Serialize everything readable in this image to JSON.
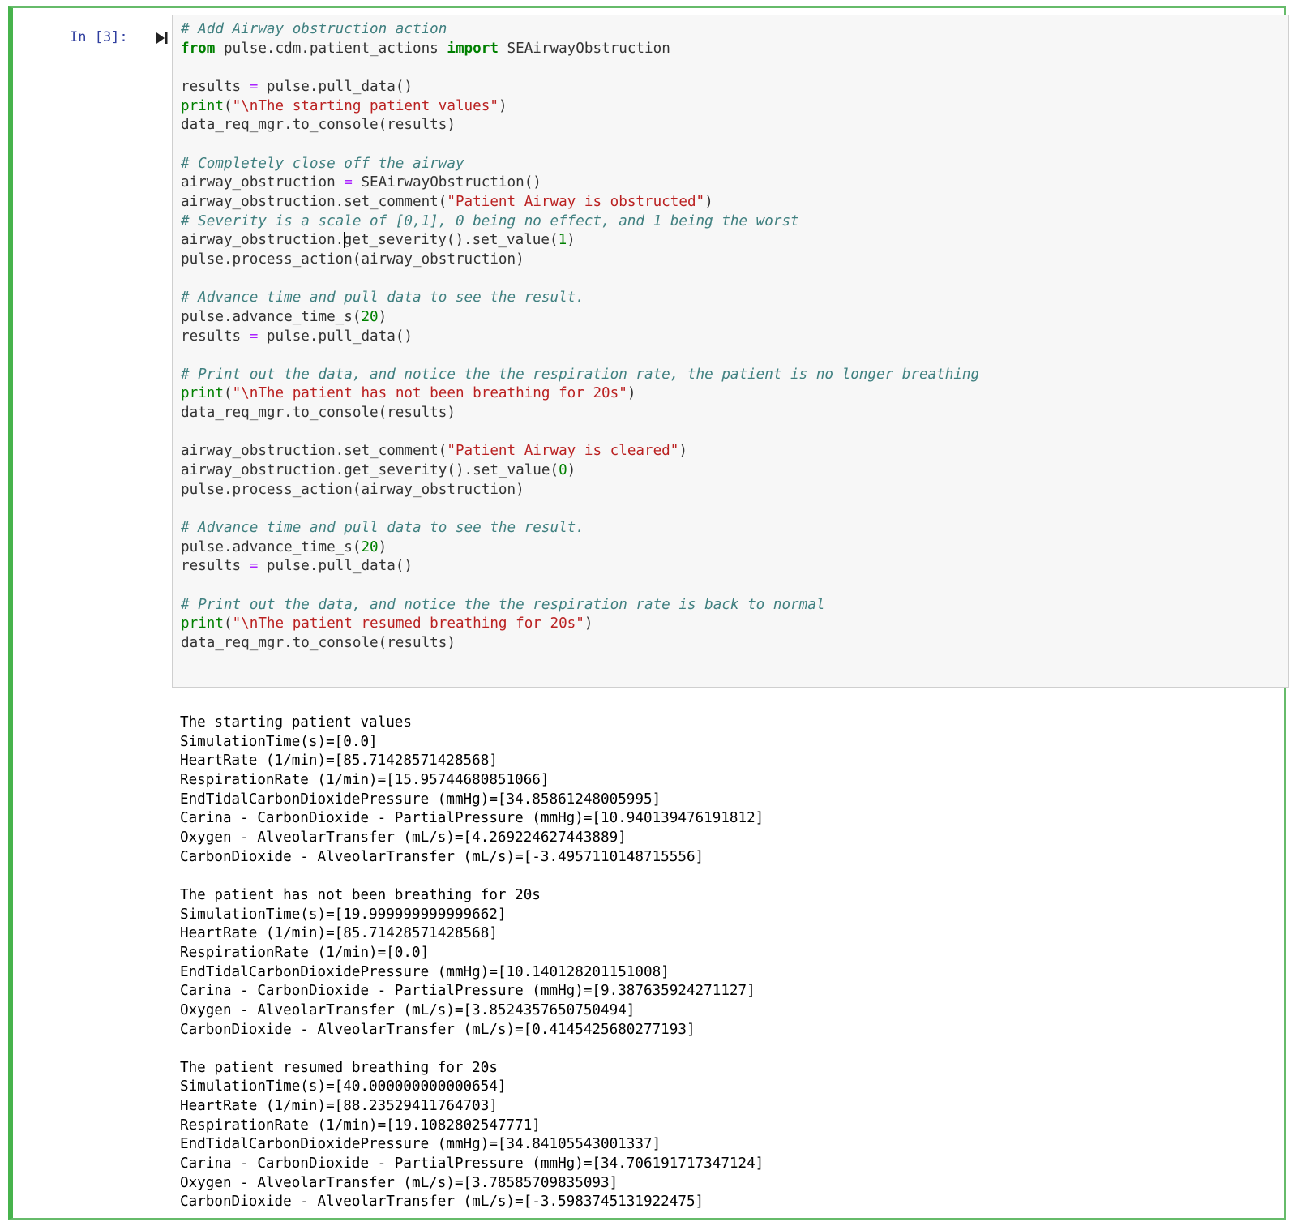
{
  "cell": {
    "prompt": "In [3]:",
    "run_icon": "run-cell-icon",
    "accent_color": "#47b34c"
  },
  "code_lines": [
    {
      "id": "l1",
      "tokens": [
        {
          "t": "cm",
          "v": "# Add Airway obstruction action"
        }
      ]
    },
    {
      "id": "l2",
      "tokens": [
        {
          "t": "kw",
          "v": "from"
        },
        {
          "t": "",
          "v": " pulse.cdm.patient_actions "
        },
        {
          "t": "kw",
          "v": "import"
        },
        {
          "t": "",
          "v": " SEAirwayObstruction"
        }
      ]
    },
    {
      "id": "l3",
      "tokens": []
    },
    {
      "id": "l4",
      "tokens": [
        {
          "t": "",
          "v": "results "
        },
        {
          "t": "op",
          "v": "="
        },
        {
          "t": "",
          "v": " pulse.pull_data()"
        }
      ]
    },
    {
      "id": "l5",
      "tokens": [
        {
          "t": "bi",
          "v": "print"
        },
        {
          "t": "",
          "v": "("
        },
        {
          "t": "str",
          "v": "\"\\nThe starting patient values\""
        },
        {
          "t": "",
          "v": ")"
        }
      ]
    },
    {
      "id": "l6",
      "tokens": [
        {
          "t": "",
          "v": "data_req_mgr.to_console(results)"
        }
      ]
    },
    {
      "id": "l7",
      "tokens": []
    },
    {
      "id": "l8",
      "tokens": [
        {
          "t": "cm",
          "v": "# Completely close off the airway"
        }
      ]
    },
    {
      "id": "l9",
      "tokens": [
        {
          "t": "",
          "v": "airway_obstruction "
        },
        {
          "t": "op",
          "v": "="
        },
        {
          "t": "",
          "v": " SEAirwayObstruction()"
        }
      ]
    },
    {
      "id": "l10",
      "tokens": [
        {
          "t": "",
          "v": "airway_obstruction.set_comment("
        },
        {
          "t": "str",
          "v": "\"Patient Airway is obstructed\""
        },
        {
          "t": "",
          "v": ")"
        }
      ]
    },
    {
      "id": "l11",
      "tokens": [
        {
          "t": "cm",
          "v": "# Severity is a scale of [0,1], 0 being no effect, and 1 being the worst"
        }
      ]
    },
    {
      "id": "l12",
      "tokens": [
        {
          "t": "",
          "v": "airway_obstruction."
        },
        {
          "t": "cursor",
          "v": ""
        },
        {
          "t": "",
          "v": "get_severity().set_value("
        },
        {
          "t": "num",
          "v": "1"
        },
        {
          "t": "",
          "v": ")"
        }
      ]
    },
    {
      "id": "l13",
      "tokens": [
        {
          "t": "",
          "v": "pulse.process_action(airway_obstruction)"
        }
      ]
    },
    {
      "id": "l14",
      "tokens": []
    },
    {
      "id": "l15",
      "tokens": [
        {
          "t": "cm",
          "v": "# Advance time and pull data to see the result."
        }
      ]
    },
    {
      "id": "l16",
      "tokens": [
        {
          "t": "",
          "v": "pulse.advance_time_s("
        },
        {
          "t": "num",
          "v": "20"
        },
        {
          "t": "",
          "v": ")"
        }
      ]
    },
    {
      "id": "l17",
      "tokens": [
        {
          "t": "",
          "v": "results "
        },
        {
          "t": "op",
          "v": "="
        },
        {
          "t": "",
          "v": " pulse.pull_data()"
        }
      ]
    },
    {
      "id": "l18",
      "tokens": []
    },
    {
      "id": "l19",
      "tokens": [
        {
          "t": "cm",
          "v": "# Print out the data, and notice the the respiration rate, the patient is no longer breathing"
        }
      ]
    },
    {
      "id": "l20",
      "tokens": [
        {
          "t": "bi",
          "v": "print"
        },
        {
          "t": "",
          "v": "("
        },
        {
          "t": "str",
          "v": "\"\\nThe patient has not been breathing for 20s\""
        },
        {
          "t": "",
          "v": ")"
        }
      ]
    },
    {
      "id": "l21",
      "tokens": [
        {
          "t": "",
          "v": "data_req_mgr.to_console(results)"
        }
      ]
    },
    {
      "id": "l22",
      "tokens": []
    },
    {
      "id": "l23",
      "tokens": [
        {
          "t": "",
          "v": "airway_obstruction.set_comment("
        },
        {
          "t": "str",
          "v": "\"Patient Airway is cleared\""
        },
        {
          "t": "",
          "v": ")"
        }
      ]
    },
    {
      "id": "l24",
      "tokens": [
        {
          "t": "",
          "v": "airway_obstruction.get_severity().set_value("
        },
        {
          "t": "num",
          "v": "0"
        },
        {
          "t": "",
          "v": ")"
        }
      ]
    },
    {
      "id": "l25",
      "tokens": [
        {
          "t": "",
          "v": "pulse.process_action(airway_obstruction)"
        }
      ]
    },
    {
      "id": "l26",
      "tokens": []
    },
    {
      "id": "l27",
      "tokens": [
        {
          "t": "cm",
          "v": "# Advance time and pull data to see the result."
        }
      ]
    },
    {
      "id": "l28",
      "tokens": [
        {
          "t": "",
          "v": "pulse.advance_time_s("
        },
        {
          "t": "num",
          "v": "20"
        },
        {
          "t": "",
          "v": ")"
        }
      ]
    },
    {
      "id": "l29",
      "tokens": [
        {
          "t": "",
          "v": "results "
        },
        {
          "t": "op",
          "v": "="
        },
        {
          "t": "",
          "v": " pulse.pull_data()"
        }
      ]
    },
    {
      "id": "l30",
      "tokens": []
    },
    {
      "id": "l31",
      "tokens": [
        {
          "t": "cm",
          "v": "# Print out the data, and notice the the respiration rate is back to normal"
        }
      ]
    },
    {
      "id": "l32",
      "tokens": [
        {
          "t": "bi",
          "v": "print"
        },
        {
          "t": "",
          "v": "("
        },
        {
          "t": "str",
          "v": "\"\\nThe patient resumed breathing for 20s\""
        },
        {
          "t": "",
          "v": ")"
        }
      ]
    },
    {
      "id": "l33",
      "tokens": [
        {
          "t": "",
          "v": "data_req_mgr.to_console(results)"
        }
      ]
    }
  ],
  "output": {
    "blocks": [
      {
        "lines": [
          "The starting patient values",
          "SimulationTime(s)=[0.0]",
          "HeartRate (1/min)=[85.71428571428568]",
          "RespirationRate (1/min)=[15.95744680851066]",
          "EndTidalCarbonDioxidePressure (mmHg)=[34.85861248005995]",
          "Carina - CarbonDioxide - PartialPressure (mmHg)=[10.940139476191812]",
          "Oxygen - AlveolarTransfer (mL/s)=[4.269224627443889]",
          "CarbonDioxide - AlveolarTransfer (mL/s)=[-3.4957110148715556]"
        ]
      },
      {
        "lines": [
          "The patient has not been breathing for 20s",
          "SimulationTime(s)=[19.999999999999662]",
          "HeartRate (1/min)=[85.71428571428568]",
          "RespirationRate (1/min)=[0.0]",
          "EndTidalCarbonDioxidePressure (mmHg)=[10.140128201151008]",
          "Carina - CarbonDioxide - PartialPressure (mmHg)=[9.387635924271127]",
          "Oxygen - AlveolarTransfer (mL/s)=[3.8524357650750494]",
          "CarbonDioxide - AlveolarTransfer (mL/s)=[0.4145425680277193]"
        ]
      },
      {
        "lines": [
          "The patient resumed breathing for 20s",
          "SimulationTime(s)=[40.000000000000654]",
          "HeartRate (1/min)=[88.23529411764703]",
          "RespirationRate (1/min)=[19.1082802547771]",
          "EndTidalCarbonDioxidePressure (mmHg)=[34.84105543001337]",
          "Carina - CarbonDioxide - PartialPressure (mmHg)=[34.706191717347124]",
          "Oxygen - AlveolarTransfer (mL/s)=[3.78585709835093]",
          "CarbonDioxide - AlveolarTransfer (mL/s)=[-3.5983745131922475]"
        ]
      }
    ]
  }
}
